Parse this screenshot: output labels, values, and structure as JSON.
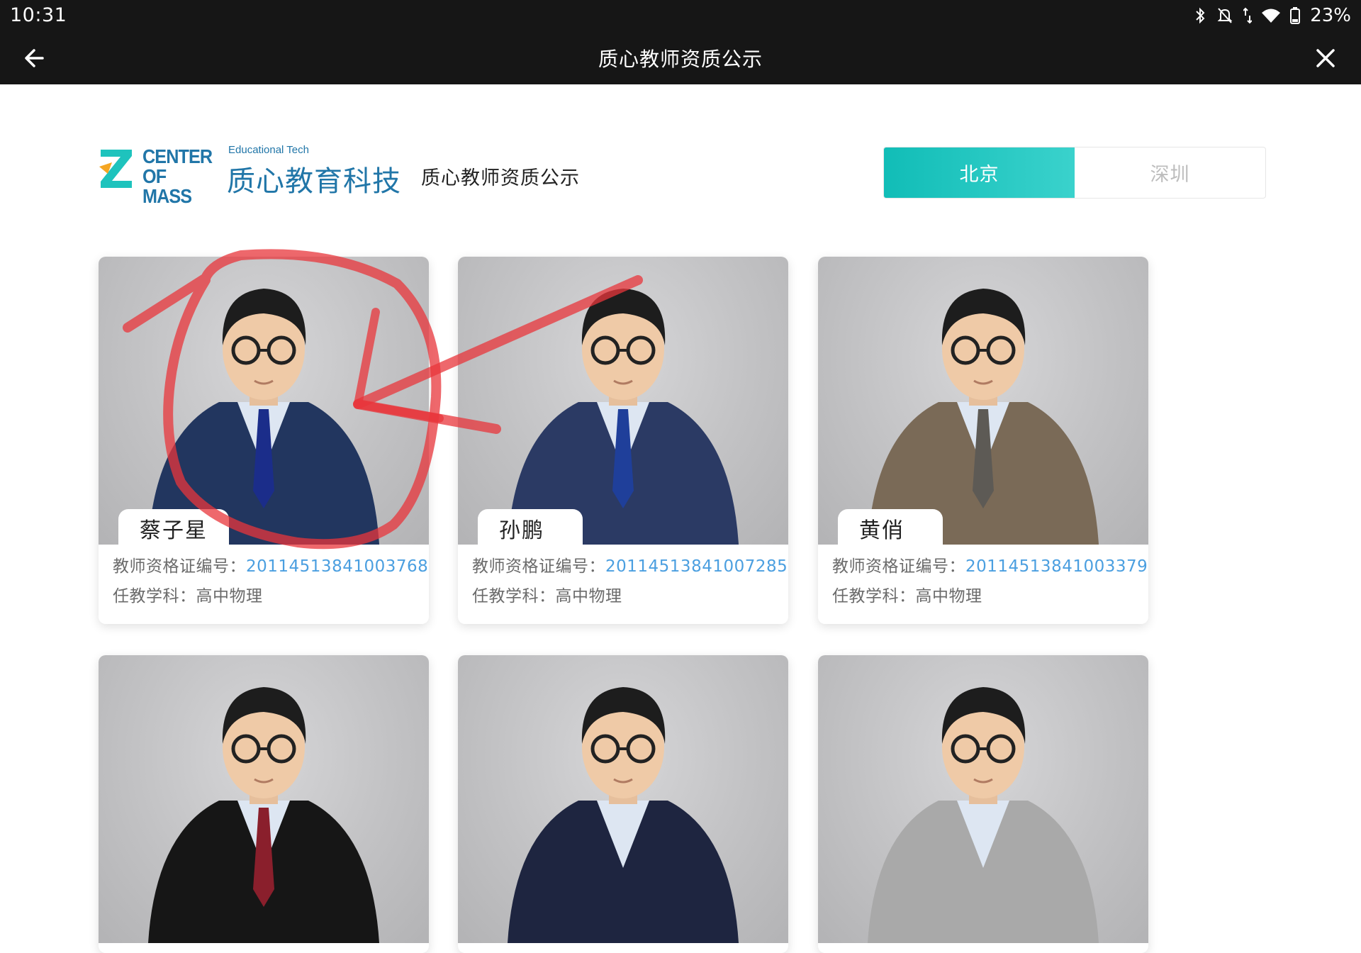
{
  "status_bar": {
    "time": "10:31",
    "battery": "23%",
    "icons": [
      "bluetooth-icon",
      "notifications-off-icon",
      "data-arrows-icon",
      "wifi-icon",
      "battery-icon"
    ]
  },
  "title_bar": {
    "title": "质心教师资质公示",
    "back_icon": "arrow-left-icon",
    "close_icon": "close-icon"
  },
  "header": {
    "logo": {
      "en_line1": "CENTER",
      "en_line2": "OF MASS",
      "tagline": "Educational Tech",
      "cn_name": "质心教育科技"
    },
    "page_heading": "质心教师资质公示",
    "city_tabs": [
      {
        "label": "北京",
        "active": true
      },
      {
        "label": "深圳",
        "active": false
      }
    ]
  },
  "labels": {
    "cert_prefix": "教师资格证编号：",
    "subject_prefix": "任教学科："
  },
  "teachers": [
    {
      "name": "蔡子星",
      "cert_no": "20114513841003768",
      "subject": "高中物理",
      "suit": "#22365f",
      "tie": "#1b2d8a"
    },
    {
      "name": "孙鹏",
      "cert_no": "20114513841007285",
      "subject": "高中物理",
      "suit": "#2b3a64",
      "tie": "#1f3f9a"
    },
    {
      "name": "黄俏",
      "cert_no": "20114513841003379",
      "subject": "高中物理",
      "suit": "#7a6a57",
      "tie": "#5d5a55"
    },
    {
      "name": "",
      "cert_no": "",
      "subject": "",
      "suit": "#161616",
      "tie": "#8a1f2c"
    },
    {
      "name": "",
      "cert_no": "",
      "subject": "",
      "suit": "#1e2540",
      "tie": ""
    },
    {
      "name": "",
      "cert_no": "",
      "subject": "",
      "suit": "#a9a9a9",
      "tie": ""
    }
  ],
  "colors": {
    "accent": "#1ec3bd",
    "logo_blue": "#2176a8",
    "link_blue": "#4b9fe0",
    "annotation_red": "#e8353b"
  }
}
